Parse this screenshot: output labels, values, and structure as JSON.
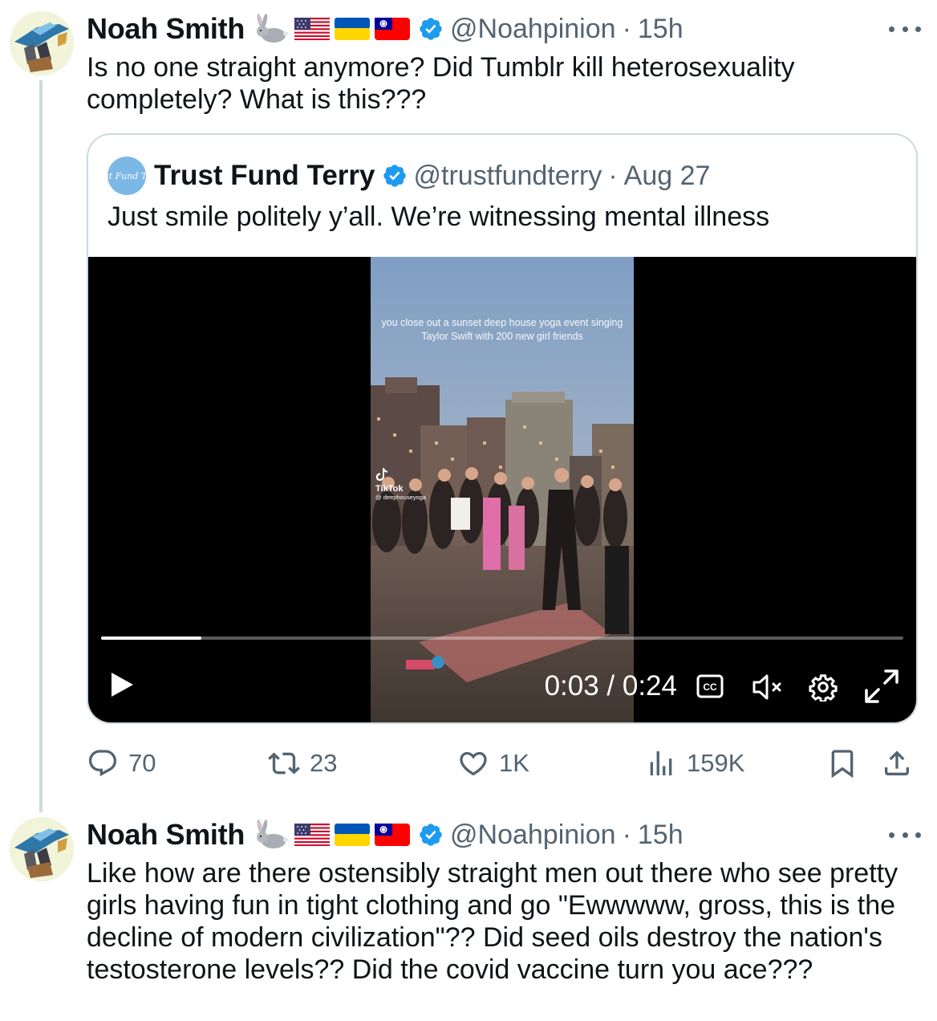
{
  "tweets": [
    {
      "author_name": "Noah Smith",
      "handle": "@Noahpinion",
      "separator": "·",
      "time": "15h",
      "badges": [
        "rabbit-emoji",
        "us-flag",
        "ukraine-flag",
        "taiwan-flag"
      ],
      "verified": true,
      "text": "Is no one straight anymore? Did Tumblr kill heterosexuality completely? What is this???"
    },
    {
      "author_name": "Noah Smith",
      "handle": "@Noahpinion",
      "separator": "·",
      "time": "15h",
      "badges": [
        "rabbit-emoji",
        "us-flag",
        "ukraine-flag",
        "taiwan-flag"
      ],
      "verified": true,
      "text": "Like how are there ostensibly straight men out there who see pretty girls having fun in tight clothing and go \"Ewwwww, gross, this is the decline of modern civilization\"?? Did seed oils destroy the nation's testosterone levels?? Did the covid vaccine turn you ace???"
    }
  ],
  "quote": {
    "avatar_text": "Trust Fund Terry",
    "author_name": "Trust Fund Terry",
    "handle": "@trustfundterry",
    "separator": "·",
    "date": "Aug 27",
    "verified": true,
    "text": "Just smile politely y’all. We’re witnessing mental illness",
    "video": {
      "overlay_text": "you close out a sunset deep house yoga event singing Taylor Swift with 200 new girl friends",
      "watermark_name": "TikTok",
      "watermark_user": "@ deephouseyoga",
      "current_time": "0:03",
      "duration": "0:24",
      "time_display": "0:03 / 0:24",
      "progress": 0.125,
      "captions_label": "CC",
      "muted": true
    }
  },
  "actions": {
    "replies": "70",
    "retweets": "23",
    "likes": "1K",
    "views": "159K"
  },
  "colors": {
    "text_primary": "#0f1419",
    "text_secondary": "#536471",
    "verified_blue": "#1d9bf0",
    "border": "#cfd9de",
    "thread_line": "#cfd9de"
  },
  "icons": [
    "more-icon",
    "verified-icon",
    "play-icon",
    "cc-icon",
    "mute-icon",
    "settings-icon",
    "fullscreen-icon",
    "reply-icon",
    "retweet-icon",
    "like-icon",
    "views-icon",
    "bookmark-icon",
    "share-icon"
  ]
}
